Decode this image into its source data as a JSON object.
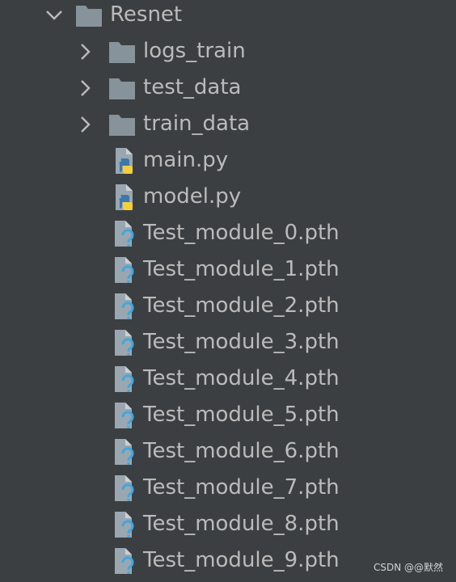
{
  "tree": {
    "root": {
      "label": "Resnet",
      "expanded": true,
      "icon": "folder-icon"
    },
    "folders": [
      {
        "label": "logs_train",
        "expanded": false,
        "icon": "folder-icon"
      },
      {
        "label": "test_data",
        "expanded": false,
        "icon": "folder-icon"
      },
      {
        "label": "train_data",
        "expanded": false,
        "icon": "folder-icon"
      }
    ],
    "python_files": [
      {
        "label": "main.py",
        "icon": "python-file-icon"
      },
      {
        "label": "model.py",
        "icon": "python-file-icon"
      }
    ],
    "unknown_files": [
      {
        "label": "Test_module_0.pth",
        "icon": "unknown-file-icon"
      },
      {
        "label": "Test_module_1.pth",
        "icon": "unknown-file-icon"
      },
      {
        "label": "Test_module_2.pth",
        "icon": "unknown-file-icon"
      },
      {
        "label": "Test_module_3.pth",
        "icon": "unknown-file-icon"
      },
      {
        "label": "Test_module_4.pth",
        "icon": "unknown-file-icon"
      },
      {
        "label": "Test_module_5.pth",
        "icon": "unknown-file-icon"
      },
      {
        "label": "Test_module_6.pth",
        "icon": "unknown-file-icon"
      },
      {
        "label": "Test_module_7.pth",
        "icon": "unknown-file-icon"
      },
      {
        "label": "Test_module_8.pth",
        "icon": "unknown-file-icon"
      },
      {
        "label": "Test_module_9.pth",
        "icon": "unknown-file-icon"
      }
    ]
  },
  "watermark": "CSDN @@默然",
  "colors": {
    "background": "#3c3f41",
    "text": "#bbbbbb",
    "folder": "#87939a",
    "python_blue": "#3c78aa",
    "python_yellow": "#f5cf3a",
    "question_blue": "#3fa7e0"
  }
}
